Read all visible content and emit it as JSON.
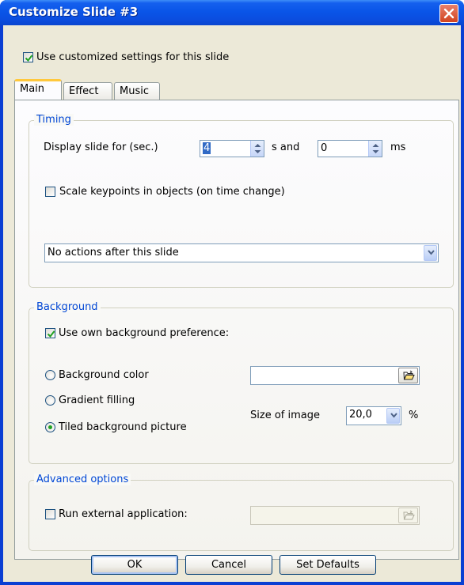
{
  "window": {
    "title": "Customize Slide #3"
  },
  "use_custom": {
    "label": "Use customized settings for this slide",
    "checked": true
  },
  "tabs": [
    {
      "label": "Main",
      "active": true
    },
    {
      "label": "Effect",
      "active": false
    },
    {
      "label": "Music",
      "active": false
    }
  ],
  "timing": {
    "group_title": "Timing",
    "display_label": "Display slide for (sec.)",
    "seconds_value": "4",
    "s_and_label": "s  and",
    "ms_value": "0",
    "ms_label": "ms",
    "scale_label": "Scale keypoints in objects (on time change)",
    "scale_checked": false,
    "action_value": "No actions after this slide"
  },
  "background": {
    "group_title": "Background",
    "own_pref_label": "Use own background preference:",
    "own_pref_checked": true,
    "options": [
      {
        "label": "Background color",
        "selected": false
      },
      {
        "label": "Gradient filling",
        "selected": false
      },
      {
        "label": "Tiled background picture",
        "selected": true
      }
    ],
    "color_value": "",
    "size_label": "Size of image",
    "size_value": "20,0",
    "percent_label": "%"
  },
  "advanced": {
    "group_title": "Advanced options",
    "run_label": "Run external application:",
    "run_checked": false,
    "app_path": ""
  },
  "buttons": {
    "ok": "OK",
    "cancel": "Cancel",
    "defaults": "Set Defaults"
  },
  "colors": {
    "title_bar": "#0a55e8",
    "dialog_bg": "#ece9d8",
    "group_title": "#0046d5",
    "close_button": "#d2431f"
  }
}
